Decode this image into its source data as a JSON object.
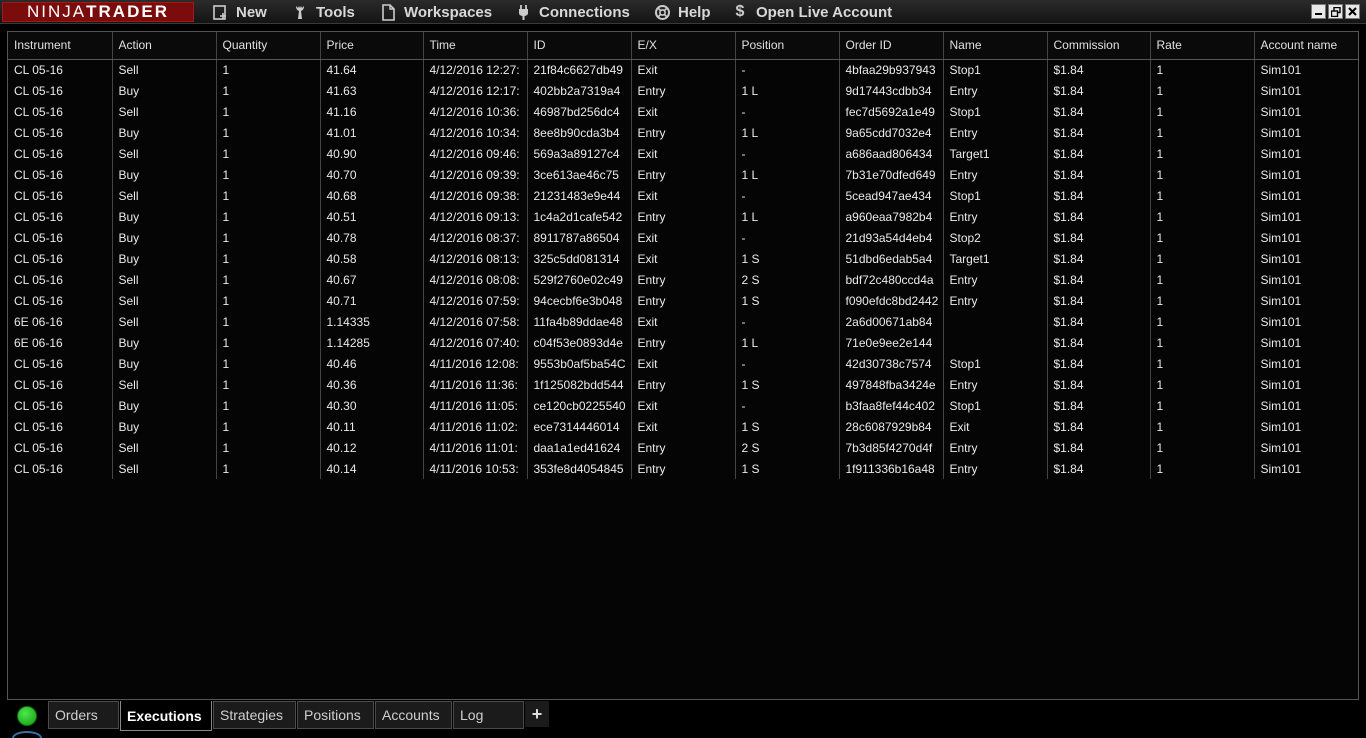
{
  "app": {
    "logo_left": "NINJA",
    "logo_right": "TRADER"
  },
  "menu": [
    {
      "label": "New",
      "icon": "new-icon"
    },
    {
      "label": "Tools",
      "icon": "wrench-icon"
    },
    {
      "label": "Workspaces",
      "icon": "document-icon"
    },
    {
      "label": "Connections",
      "icon": "plug-icon"
    },
    {
      "label": "Help",
      "icon": "lifebuoy-icon"
    },
    {
      "label": "Open Live Account",
      "icon": "dollar-icon"
    }
  ],
  "grid": {
    "columns": [
      "Instrument",
      "Action",
      "Quantity",
      "Price",
      "Time",
      "ID",
      "E/X",
      "Position",
      "Order ID",
      "Name",
      "Commission",
      "Rate",
      "Account name"
    ],
    "rows": [
      [
        "CL 05-16",
        "Sell",
        "1",
        "41.64",
        "4/12/2016 12:27:",
        "21f84c6627db49",
        "Exit",
        "-",
        "4bfaa29b937943",
        "Stop1",
        "$1.84",
        "1",
        "Sim101"
      ],
      [
        "CL 05-16",
        "Buy",
        "1",
        "41.63",
        "4/12/2016 12:17:",
        "402bb2a7319a4",
        "Entry",
        "1 L",
        "9d17443cdbb34",
        "Entry",
        "$1.84",
        "1",
        "Sim101"
      ],
      [
        "CL 05-16",
        "Sell",
        "1",
        "41.16",
        "4/12/2016 10:36:",
        "46987bd256dc4",
        "Exit",
        "-",
        "fec7d5692a1e49",
        "Stop1",
        "$1.84",
        "1",
        "Sim101"
      ],
      [
        "CL 05-16",
        "Buy",
        "1",
        "41.01",
        "4/12/2016 10:34:",
        "8ee8b90cda3b4",
        "Entry",
        "1 L",
        "9a65cdd7032e4",
        "Entry",
        "$1.84",
        "1",
        "Sim101"
      ],
      [
        "CL 05-16",
        "Sell",
        "1",
        "40.90",
        "4/12/2016 09:46:",
        "569a3a89127c4",
        "Exit",
        "-",
        "a686aad806434",
        "Target1",
        "$1.84",
        "1",
        "Sim101"
      ],
      [
        "CL 05-16",
        "Buy",
        "1",
        "40.70",
        "4/12/2016 09:39:",
        "3ce613ae46c75",
        "Entry",
        "1 L",
        "7b31e70dfed649",
        "Entry",
        "$1.84",
        "1",
        "Sim101"
      ],
      [
        "CL 05-16",
        "Sell",
        "1",
        "40.68",
        "4/12/2016 09:38:",
        "21231483e9e44",
        "Exit",
        "-",
        "5cead947ae434",
        "Stop1",
        "$1.84",
        "1",
        "Sim101"
      ],
      [
        "CL 05-16",
        "Buy",
        "1",
        "40.51",
        "4/12/2016 09:13:",
        "1c4a2d1cafe542",
        "Entry",
        "1 L",
        "a960eaa7982b4",
        "Entry",
        "$1.84",
        "1",
        "Sim101"
      ],
      [
        "CL 05-16",
        "Buy",
        "1",
        "40.78",
        "4/12/2016 08:37:",
        "8911787a86504",
        "Exit",
        "-",
        "21d93a54d4eb4",
        "Stop2",
        "$1.84",
        "1",
        "Sim101"
      ],
      [
        "CL 05-16",
        "Buy",
        "1",
        "40.58",
        "4/12/2016 08:13:",
        "325c5dd081314",
        "Exit",
        "1 S",
        "51dbd6edab5a4",
        "Target1",
        "$1.84",
        "1",
        "Sim101"
      ],
      [
        "CL 05-16",
        "Sell",
        "1",
        "40.67",
        "4/12/2016 08:08:",
        "529f2760e02c49",
        "Entry",
        "2 S",
        "bdf72c480ccd4a",
        "Entry",
        "$1.84",
        "1",
        "Sim101"
      ],
      [
        "CL 05-16",
        "Sell",
        "1",
        "40.71",
        "4/12/2016 07:59:",
        "94cecbf6e3b048",
        "Entry",
        "1 S",
        "f090efdc8bd2442",
        "Entry",
        "$1.84",
        "1",
        "Sim101"
      ],
      [
        "6E 06-16",
        "Sell",
        "1",
        "1.14335",
        "4/12/2016 07:58:",
        "11fa4b89ddae48",
        "Exit",
        "-",
        "2a6d00671ab84",
        "",
        "$1.84",
        "1",
        "Sim101"
      ],
      [
        "6E 06-16",
        "Buy",
        "1",
        "1.14285",
        "4/12/2016 07:40:",
        "c04f53e0893d4e",
        "Entry",
        "1 L",
        "71e0e9ee2e144",
        "",
        "$1.84",
        "1",
        "Sim101"
      ],
      [
        "CL 05-16",
        "Buy",
        "1",
        "40.46",
        "4/11/2016 12:08:",
        "9553b0af5ba54C",
        "Exit",
        "-",
        "42d30738c7574",
        "Stop1",
        "$1.84",
        "1",
        "Sim101"
      ],
      [
        "CL 05-16",
        "Sell",
        "1",
        "40.36",
        "4/11/2016 11:36:",
        "1f125082bdd544",
        "Entry",
        "1 S",
        "497848fba3424e",
        "Entry",
        "$1.84",
        "1",
        "Sim101"
      ],
      [
        "CL 05-16",
        "Buy",
        "1",
        "40.30",
        "4/11/2016 11:05:",
        "ce120cb0225540",
        "Exit",
        "-",
        "b3faa8fef44c402",
        "Stop1",
        "$1.84",
        "1",
        "Sim101"
      ],
      [
        "CL 05-16",
        "Buy",
        "1",
        "40.11",
        "4/11/2016 11:02:",
        "ece7314446014",
        "Exit",
        "1 S",
        "28c6087929b84",
        "Exit",
        "$1.84",
        "1",
        "Sim101"
      ],
      [
        "CL 05-16",
        "Sell",
        "1",
        "40.12",
        "4/11/2016 11:01:",
        "daa1a1ed41624",
        "Entry",
        "2 S",
        "7b3d85f4270d4f",
        "Entry",
        "$1.84",
        "1",
        "Sim101"
      ],
      [
        "CL 05-16",
        "Sell",
        "1",
        "40.14",
        "4/11/2016 10:53:",
        "353fe8d4054845",
        "Entry",
        "1 S",
        "1f911336b16a48",
        "Entry",
        "$1.84",
        "1",
        "Sim101"
      ]
    ]
  },
  "tabs": [
    {
      "label": "Orders",
      "active": false
    },
    {
      "label": "Executions",
      "active": true
    },
    {
      "label": "Strategies",
      "active": false
    },
    {
      "label": "Positions",
      "active": false
    },
    {
      "label": "Accounts",
      "active": false
    },
    {
      "label": "Log",
      "active": false
    }
  ],
  "add_tab_label": "+",
  "colors": {
    "logo_bg": "#7a0c0c",
    "status_ok": "#22c022"
  }
}
